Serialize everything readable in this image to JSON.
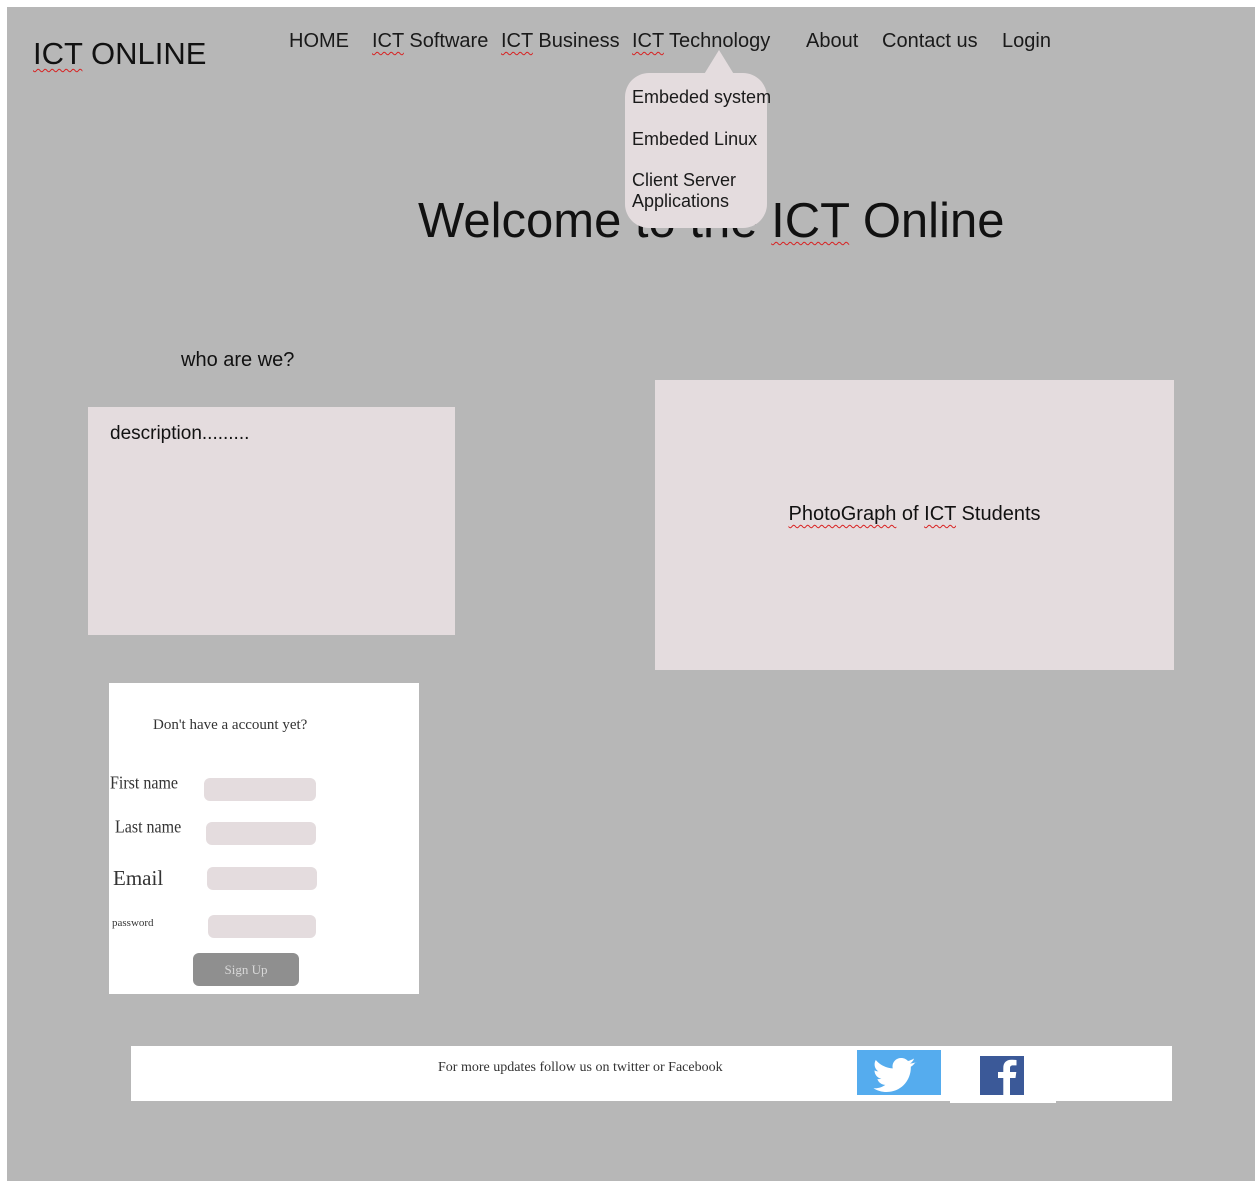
{
  "logo": {
    "squiggle_part": "ICT",
    "rest": " ONLINE"
  },
  "nav": {
    "home": "HOME",
    "software": {
      "squiggle_part": "ICT",
      "rest": " Software"
    },
    "business": {
      "squiggle_part": "ICT",
      "rest": " Business"
    },
    "technology": {
      "squiggle_part": "ICT",
      "rest": " Technology"
    },
    "about": "About",
    "contact": "Contact us",
    "login": "Login"
  },
  "dropdown": {
    "items": [
      "Embeded system",
      "Embeded Linux",
      "Client Server",
      "Applications"
    ]
  },
  "welcome": {
    "before": "Welcome to the ",
    "squiggle_part": "ICT",
    "after": " Online"
  },
  "about_section": {
    "heading": "who are we?",
    "description": "description........."
  },
  "photo": {
    "squiggle_1": "PhotoGraph",
    "middle": " of ",
    "squiggle_2": "ICT",
    "after": " Students"
  },
  "signup_form": {
    "title": "Don't have a account yet?",
    "first_name_label": "First name",
    "last_name_label": "Last name",
    "email_label": "Email",
    "password_label": "password",
    "submit_label": "Sign Up"
  },
  "footer": {
    "text": "For more updates follow us on twitter or Facebook",
    "twitter_icon": "twitter-bird-icon",
    "facebook_icon": "facebook-f-icon"
  },
  "colors": {
    "background": "#b7b7b7",
    "panel": "#e4dcde",
    "twitter": "#55acee",
    "facebook": "#3b5998",
    "spellcheck_underline": "#d82020"
  }
}
